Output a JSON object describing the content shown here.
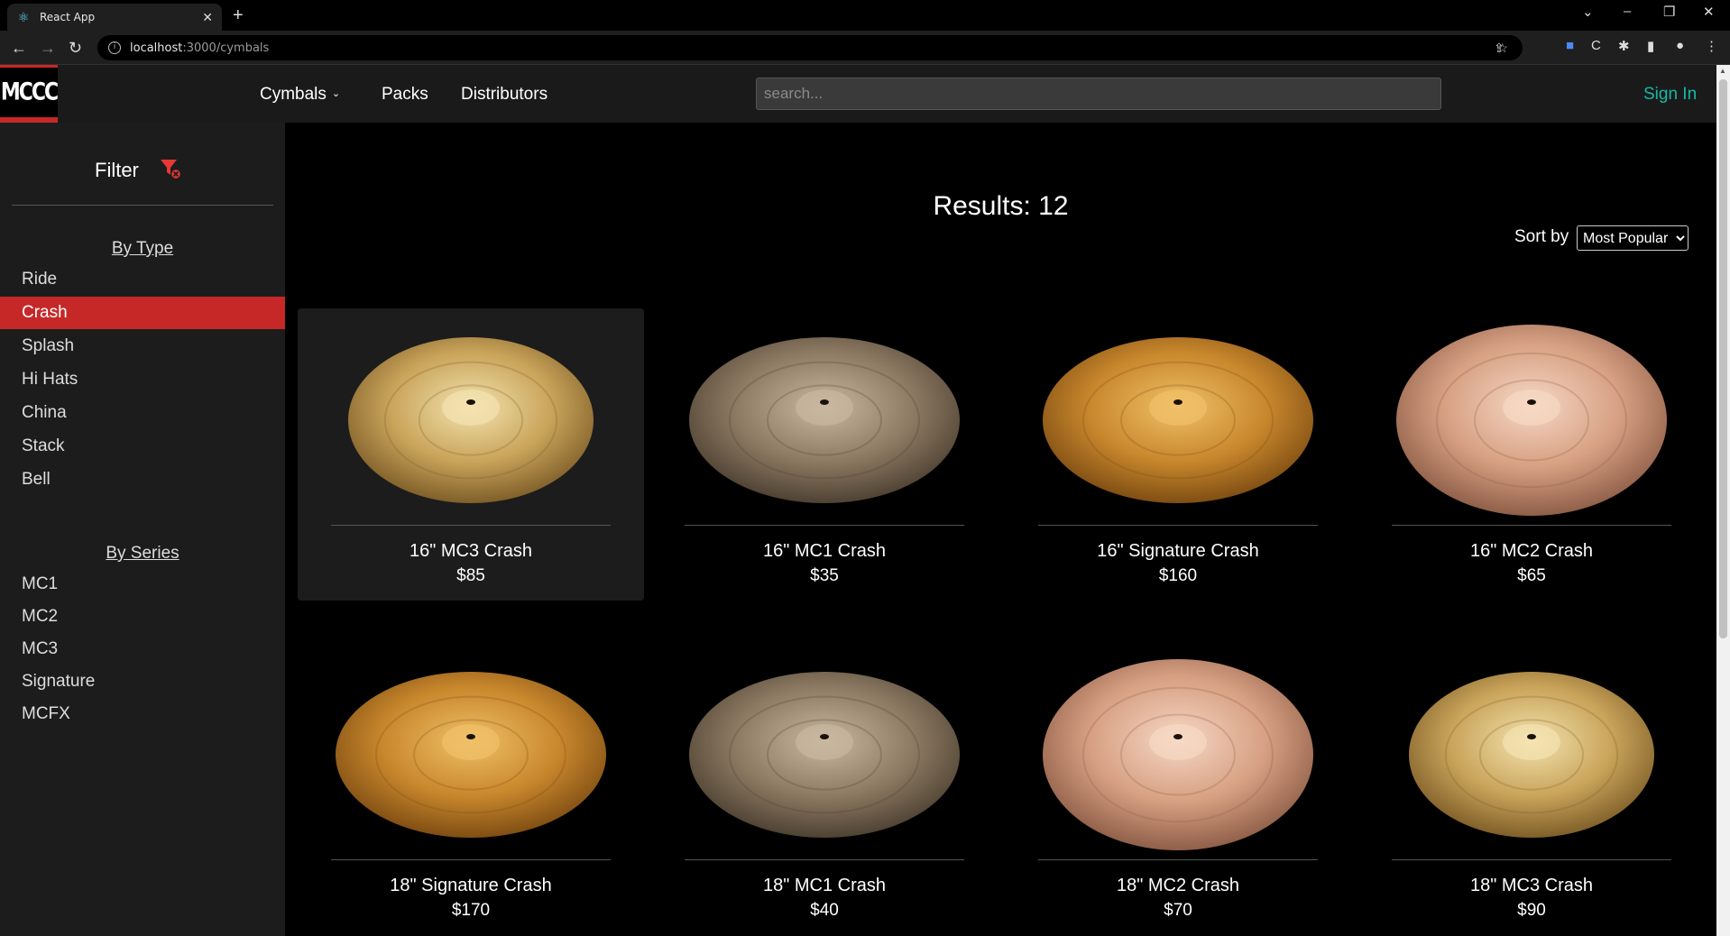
{
  "browser": {
    "tab_title": "React App",
    "url_host": "localhost",
    "url_path": ":3000/cymbals"
  },
  "header": {
    "logo": "MCCC",
    "nav": [
      "Cymbals",
      "Packs",
      "Distributors"
    ],
    "search_placeholder": "search...",
    "sign_in": "Sign In"
  },
  "sidebar": {
    "title": "Filter",
    "type_heading": "By Type",
    "types": [
      "Ride",
      "Crash",
      "Splash",
      "Hi Hats",
      "China",
      "Stack",
      "Bell"
    ],
    "active_type": "Crash",
    "series_heading": "By Series",
    "series": [
      "MC1",
      "MC2",
      "MC3",
      "Signature",
      "MCFX"
    ]
  },
  "main": {
    "results": "Results: 12",
    "sort_label": "Sort by",
    "sort_value": "Most Popular"
  },
  "products": [
    {
      "name": "16\" MC3 Crash",
      "price": "$85",
      "finish": "mc3"
    },
    {
      "name": "16\" MC1 Crash",
      "price": "$35",
      "finish": "mc1"
    },
    {
      "name": "16\" Signature Crash",
      "price": "$160",
      "finish": "sig"
    },
    {
      "name": "16\" MC2 Crash",
      "price": "$65",
      "finish": "mc2"
    },
    {
      "name": "18\" Signature Crash",
      "price": "$170",
      "finish": "sig"
    },
    {
      "name": "18\" MC1 Crash",
      "price": "$40",
      "finish": "mc1"
    },
    {
      "name": "18\" MC2 Crash",
      "price": "$70",
      "finish": "mc2"
    },
    {
      "name": "18\" MC3 Crash",
      "price": "$90",
      "finish": "mc3"
    }
  ],
  "colors": {
    "accent_red": "#c62828",
    "signin_teal": "#17b8a6"
  }
}
